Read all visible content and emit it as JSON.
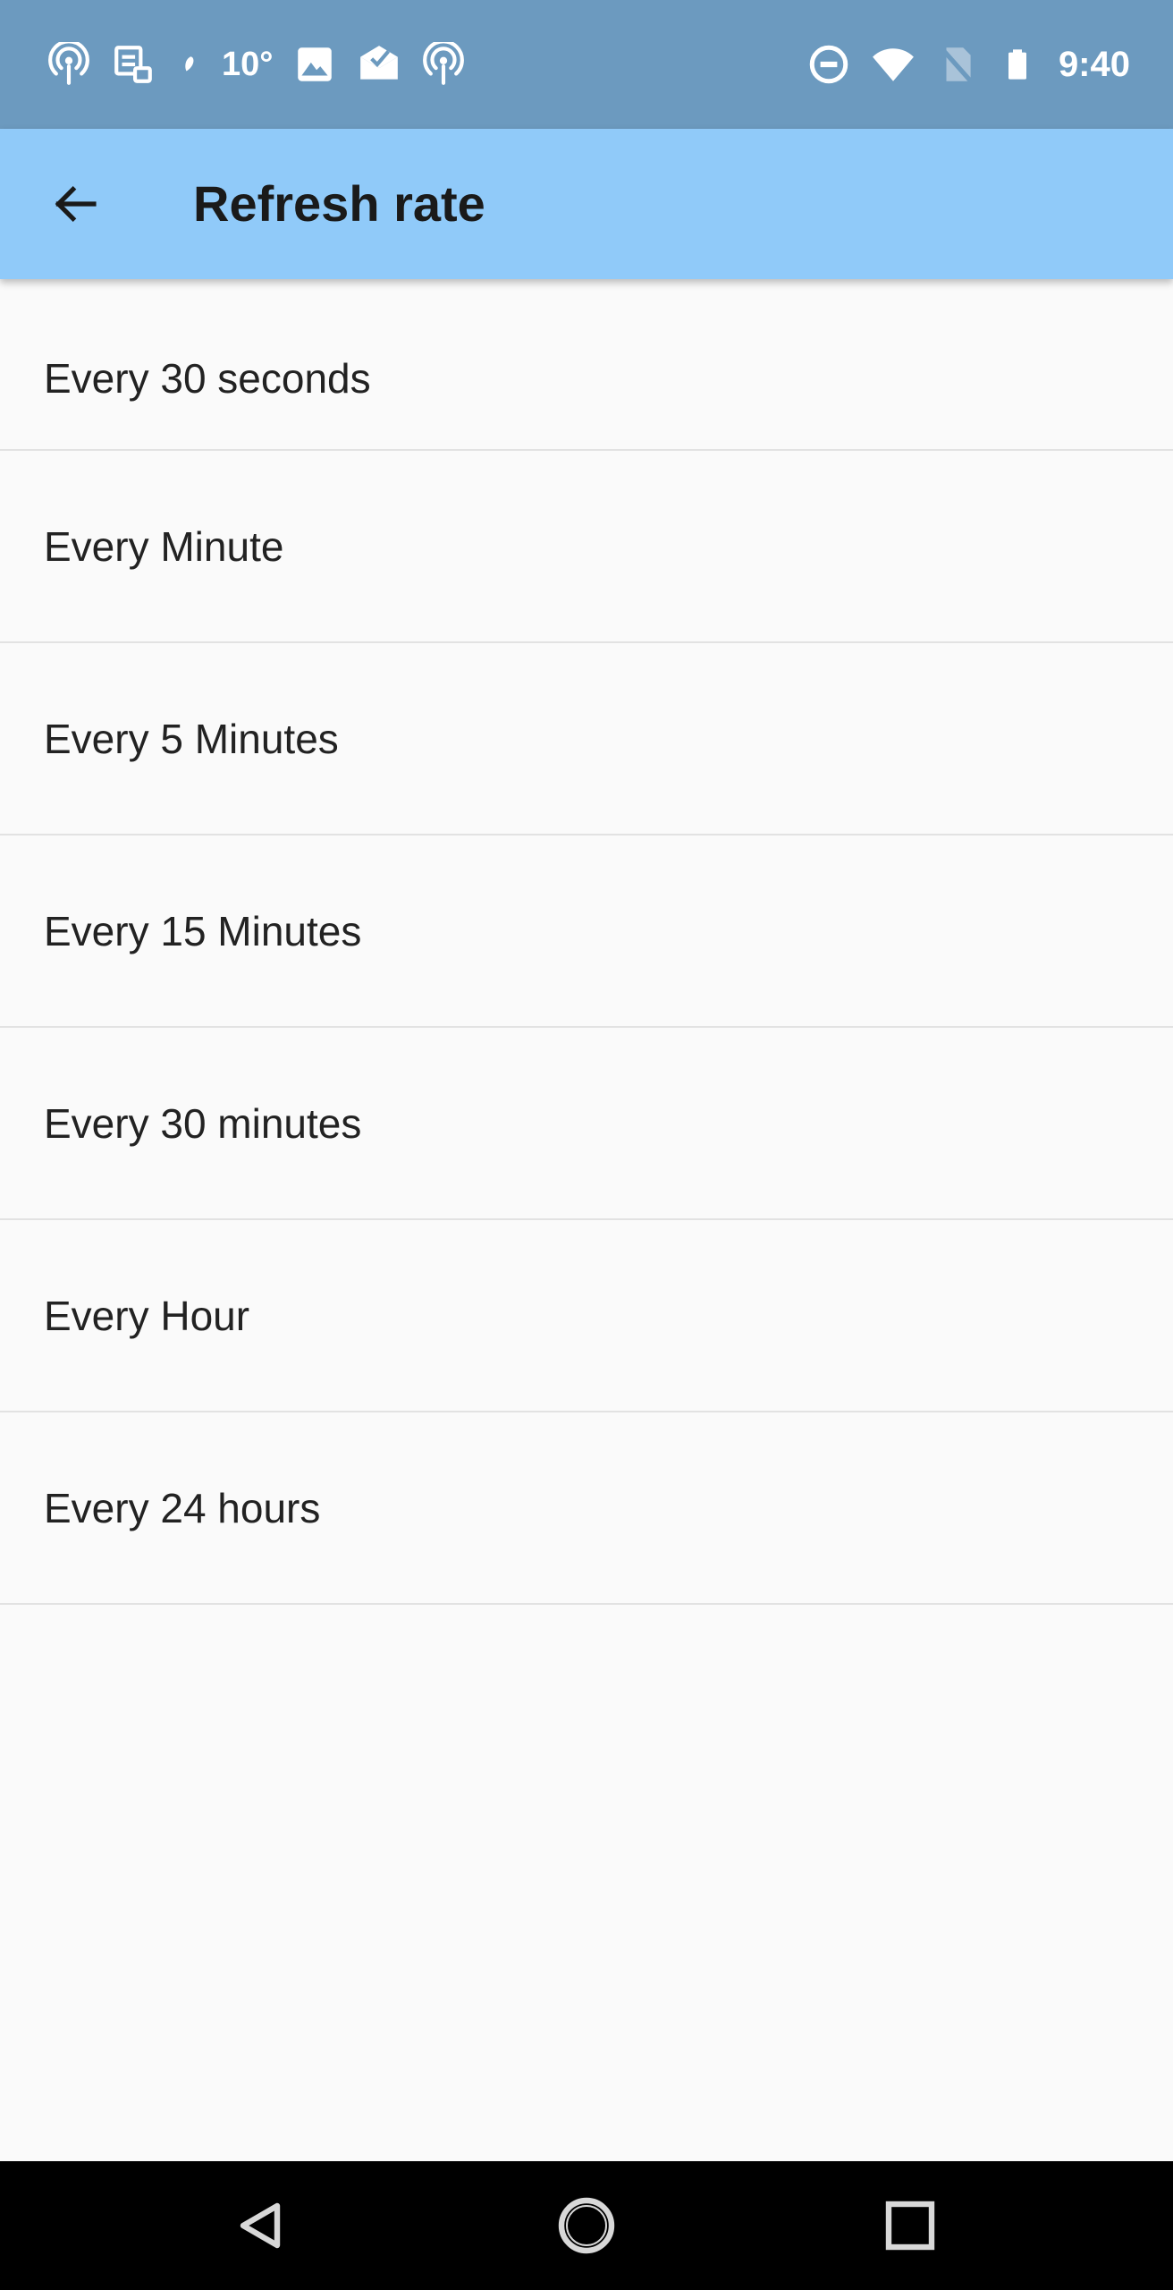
{
  "status_bar": {
    "left_icons": [
      "podcast-icon",
      "tasks-icon",
      "leaf-icon",
      "temperature-value",
      "image-icon",
      "mail-check-icon",
      "podcast-icon"
    ],
    "temperature": "10°",
    "time": "9:40",
    "right_icons": [
      "do-not-disturb-icon",
      "wifi-icon",
      "no-sim-icon",
      "battery-icon"
    ],
    "background_color": "#6c9abf"
  },
  "app_bar": {
    "title": "Refresh rate",
    "back_icon": "arrow-back-icon",
    "background_color": "#90caf9"
  },
  "refresh_options": [
    {
      "label": "Every 30 seconds"
    },
    {
      "label": "Every Minute"
    },
    {
      "label": "Every 5 Minutes"
    },
    {
      "label": "Every 15 Minutes"
    },
    {
      "label": "Every 30 minutes"
    },
    {
      "label": "Every Hour"
    },
    {
      "label": "Every 24 hours"
    }
  ],
  "nav_bar": {
    "buttons": [
      "back-triangle-icon",
      "home-circle-icon",
      "recents-square-icon"
    ]
  }
}
